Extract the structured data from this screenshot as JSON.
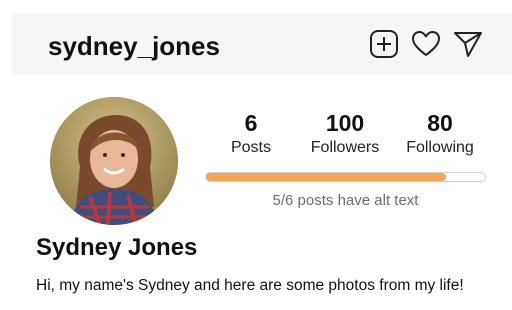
{
  "header": {
    "username": "sydney_jones",
    "icons": [
      "add-post-icon",
      "heart-icon",
      "send-icon"
    ]
  },
  "profile": {
    "avatar": "profile-photo",
    "stats": [
      {
        "value": "6",
        "label": "Posts"
      },
      {
        "value": "100",
        "label": "Followers"
      },
      {
        "value": "80",
        "label": "Following"
      }
    ],
    "alt_text_progress": 0.86,
    "alt_text_label": "5/6 posts have alt text",
    "display_name": "Sydney Jones",
    "bio": "Hi, my name's Sydney and here are some photos from my life!"
  },
  "colors": {
    "progress_fill": "#f3a55a",
    "header_bg": "#f6f6f6"
  }
}
